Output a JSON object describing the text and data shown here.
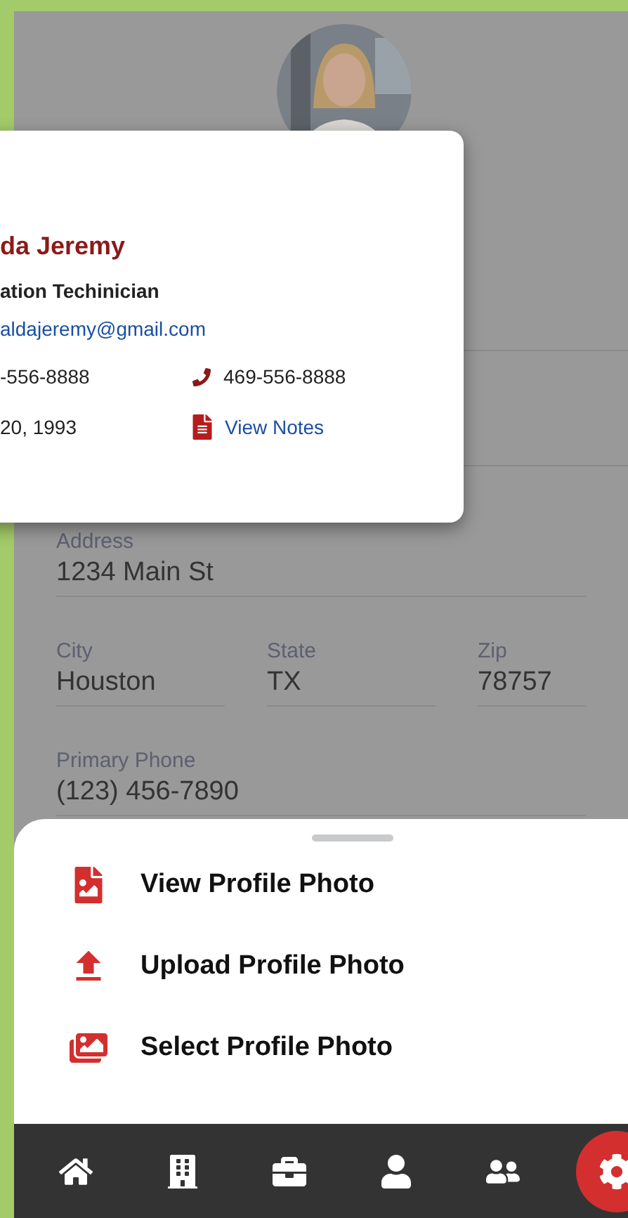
{
  "profile_card": {
    "name": "da Jeremy",
    "title": "ation Techinician",
    "email": "aldajeremy@gmail.com",
    "phone_1": "-556-8888",
    "phone_2": "469-556-8888",
    "birth_date": " 20, 1993",
    "notes_link": "View Notes"
  },
  "form": {
    "address": {
      "label": "Address",
      "value": "1234 Main St"
    },
    "city": {
      "label": "City",
      "value": "Houston"
    },
    "state": {
      "label": "State",
      "value": "TX"
    },
    "zip": {
      "label": "Zip",
      "value": "78757"
    },
    "primary_phone": {
      "label": "Primary Phone",
      "value": "(123) 456-7890"
    }
  },
  "photo_menu": [
    {
      "kind": "view",
      "label": "View Profile Photo"
    },
    {
      "kind": "upload",
      "label": "Upload Profile Photo"
    },
    {
      "kind": "select",
      "label": "Select Profile Photo"
    }
  ],
  "nav_bar": [
    {
      "kind": "home",
      "selected": false
    },
    {
      "kind": "building",
      "selected": false
    },
    {
      "kind": "briefcase",
      "selected": false
    },
    {
      "kind": "user",
      "selected": false
    },
    {
      "kind": "users",
      "selected": false
    },
    {
      "kind": "settings",
      "selected": true
    }
  ]
}
